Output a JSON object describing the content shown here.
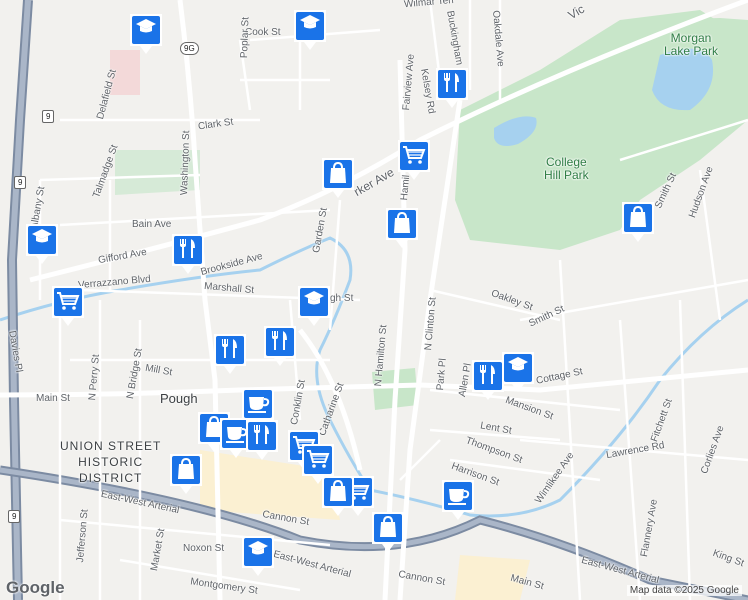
{
  "map": {
    "attribution": "Map data ©2025 Google",
    "logo": "Google",
    "colors": {
      "marker": "#1a73e8",
      "park": "#c8e6c9",
      "water": "#a6d1ef",
      "road": "#ffffff",
      "highway": "#7c8ba2"
    }
  },
  "places": {
    "morgan_lake_park": "Morgan\nLake Park",
    "college_hill_park": "College\nHill Park",
    "union_street": "UNION STREET\nHISTORIC\nDISTRICT",
    "pough": "Pough"
  },
  "streets": {
    "cook": "Cook St",
    "poplar": "Poplar St",
    "clark": "Clark St",
    "delafield": "Delafield St",
    "washington": "Washington St",
    "albany": "Albany St",
    "talmadge": "Talmadge St",
    "bain": "Bain Ave",
    "gifford": "Gifford Ave",
    "brookside": "Brookside Ave",
    "verrazzano": "Verrazzano Blvd",
    "marshall": "Marshall St",
    "garden": "Garden St",
    "davies": "Davies Pl",
    "perry": "N Perry St",
    "bridge": "N Bridge St",
    "mill": "Mill St",
    "main_w": "Main St",
    "jefferson": "Jefferson St",
    "market": "Market St",
    "noxon": "Noxon St",
    "cannon": "Cannon St",
    "cannon2": "Cannon St",
    "montgomery": "Montgomery St",
    "ew1": "East-West Arterial",
    "ew2": "East-West Arterial",
    "ew3": "East-West Arterial",
    "conklin": "Conklin St",
    "catharine": "Catharine St",
    "n_hamilton": "N Hamilton St",
    "n_clinton": "N Clinton St",
    "park_pl": "Park Pl",
    "allen": "Allen Pl",
    "oakley": "Oakley St",
    "smith": "Smith St",
    "smith2": "Smith St",
    "hudson": "Hudson Ave",
    "cottage": "Cottage St",
    "mansion": "Mansion St",
    "lent": "Lent St",
    "thompson": "Thompson St",
    "harrison": "Harrison St",
    "wimlikee": "Wimlikee Ave",
    "lawrence": "Lawrence Rd",
    "fitchett": "Fitchett St",
    "corlies": "Corlies Ave",
    "flannery": "Flannery Ave",
    "king": "King St",
    "main_e": "Main St",
    "fairview": "Fairview Ave",
    "kelsey": "Kelsey Rd",
    "buckingham": "Buckingham",
    "oakdale": "Oakdale Ave",
    "wilmar": "Wilmar Terr",
    "parker": "rker Ave",
    "hamilton_top": "Hamil",
    "vic": "Vic",
    "high": "gh St"
  },
  "shields": {
    "r9g": "9G",
    "r9a": "9",
    "r9b": "9",
    "r9c": "9",
    "r9d": "9"
  },
  "markers": [
    {
      "icon": "school"
    },
    {
      "icon": "school"
    },
    {
      "icon": "restaurant"
    },
    {
      "icon": "grocery"
    },
    {
      "icon": "shopping"
    },
    {
      "icon": "shopping"
    },
    {
      "icon": "shopping"
    },
    {
      "icon": "school"
    },
    {
      "icon": "restaurant"
    },
    {
      "icon": "grocery"
    },
    {
      "icon": "school"
    },
    {
      "icon": "restaurant"
    },
    {
      "icon": "restaurant"
    },
    {
      "icon": "restaurant"
    },
    {
      "icon": "school"
    },
    {
      "icon": "cafe"
    },
    {
      "icon": "shopping"
    },
    {
      "icon": "cafe"
    },
    {
      "icon": "restaurant"
    },
    {
      "icon": "grocery"
    },
    {
      "icon": "grocery"
    },
    {
      "icon": "grocery"
    },
    {
      "icon": "shopping"
    },
    {
      "icon": "shopping"
    },
    {
      "icon": "shopping"
    },
    {
      "icon": "cafe"
    },
    {
      "icon": "school"
    }
  ]
}
